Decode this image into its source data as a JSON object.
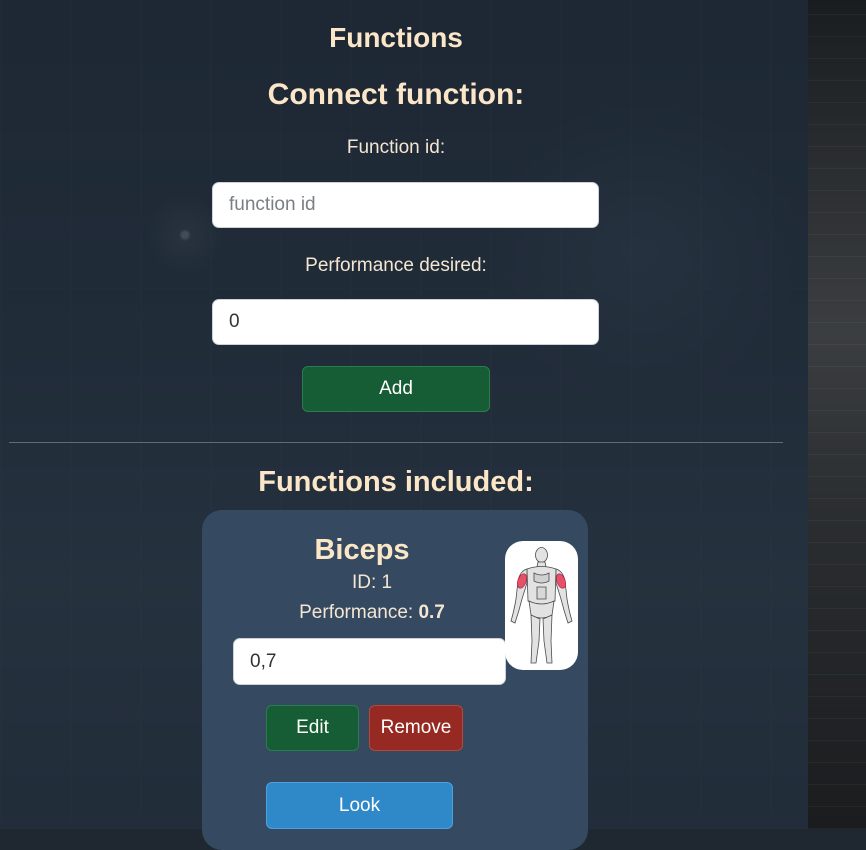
{
  "page": {
    "title": "Functions"
  },
  "connect": {
    "heading": "Connect function:",
    "function_id_label": "Function id:",
    "function_id_placeholder": "function id",
    "function_id_value": "",
    "performance_label": "Performance desired:",
    "performance_value": "0",
    "add_label": "Add"
  },
  "included": {
    "heading": "Functions included:",
    "items": [
      {
        "name": "Biceps",
        "id_text": "ID: 1",
        "performance_label": "Performance:",
        "performance_value": "0.7",
        "edit_value": "0,7",
        "edit_label": "Edit",
        "remove_label": "Remove",
        "look_label": "Look",
        "image_icon": "muscle-anatomy-icon"
      }
    ]
  },
  "colors": {
    "heading": "#fbe6c8",
    "card": "#354a60",
    "success": "#165c34",
    "danger": "#962a22",
    "info": "#2f88c8",
    "muscle_highlight": "#e8506a"
  }
}
